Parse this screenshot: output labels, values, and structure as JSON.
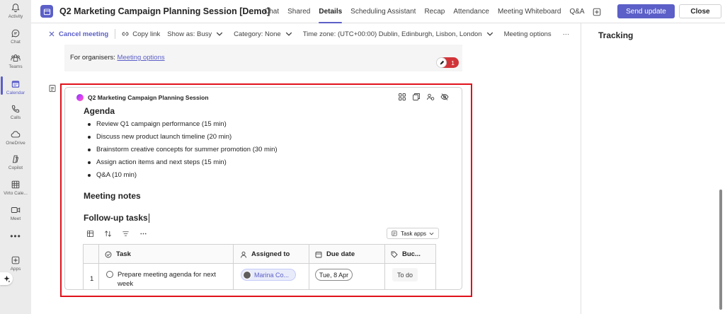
{
  "rail": {
    "items": [
      {
        "label": "Activity",
        "icon": "bell-icon"
      },
      {
        "label": "Chat",
        "icon": "chat-icon"
      },
      {
        "label": "Teams",
        "icon": "teams-icon"
      },
      {
        "label": "Calendar",
        "icon": "calendar-icon",
        "active": true
      },
      {
        "label": "Calls",
        "icon": "phone-icon"
      },
      {
        "label": "OneDrive",
        "icon": "cloud-icon"
      },
      {
        "label": "Copilot",
        "icon": "copilot-icon"
      },
      {
        "label": "Virto Cale...",
        "icon": "grid-calendar-icon"
      },
      {
        "label": "Meet",
        "icon": "video-icon"
      },
      {
        "label": "Apps",
        "icon": "plus-square-icon"
      }
    ],
    "more": "•••",
    "accent_color": "#5b5fc7"
  },
  "header": {
    "title": "Q2 Marketing Campaign Planning Session [Demo]",
    "tabs": [
      {
        "label": "Chat"
      },
      {
        "label": "Shared"
      },
      {
        "label": "Details",
        "active": true
      },
      {
        "label": "Scheduling Assistant"
      },
      {
        "label": "Recap"
      },
      {
        "label": "Attendance"
      },
      {
        "label": "Meeting Whiteboard"
      },
      {
        "label": "Q&A"
      }
    ],
    "send_update": "Send update",
    "close": "Close"
  },
  "toolbar": {
    "cancel_meeting": "Cancel meeting",
    "copy_link": "Copy link",
    "show_as": "Show as: Busy",
    "category": "Category: None",
    "time_zone": "Time zone: (UTC+00:00) Dublin, Edinburgh, Lisbon, London",
    "meeting_options": "Meeting options",
    "more": "···"
  },
  "right_panel": {
    "title": "Tracking"
  },
  "organiser": {
    "prefix": "For organisers:",
    "link": "Meeting options",
    "badge_count": "1"
  },
  "loop": {
    "title": "Q2 Marketing Campaign Planning Session",
    "agenda_heading": "Agenda",
    "agenda_items": [
      "Review Q1 campaign performance (15 min)",
      "Discuss new product launch timeline (20 min)",
      "Brainstorm creative concepts for summer promotion (30 min)",
      "Assign action items and next steps (15 min)",
      "Q&A (10 min)"
    ],
    "notes_heading": "Meeting notes",
    "tasks_heading": "Follow-up tasks",
    "task_apps": "Task apps",
    "table": {
      "headers": {
        "task": "Task",
        "assigned_to": "Assigned to",
        "due_date": "Due date",
        "bucket": "Buc..."
      },
      "rows": [
        {
          "num": "1",
          "task": "Prepare meeting agenda for next week",
          "assigned_to": "Marina Co...",
          "due_date": "Tue, 8 Apr",
          "bucket": "To do"
        }
      ]
    }
  }
}
